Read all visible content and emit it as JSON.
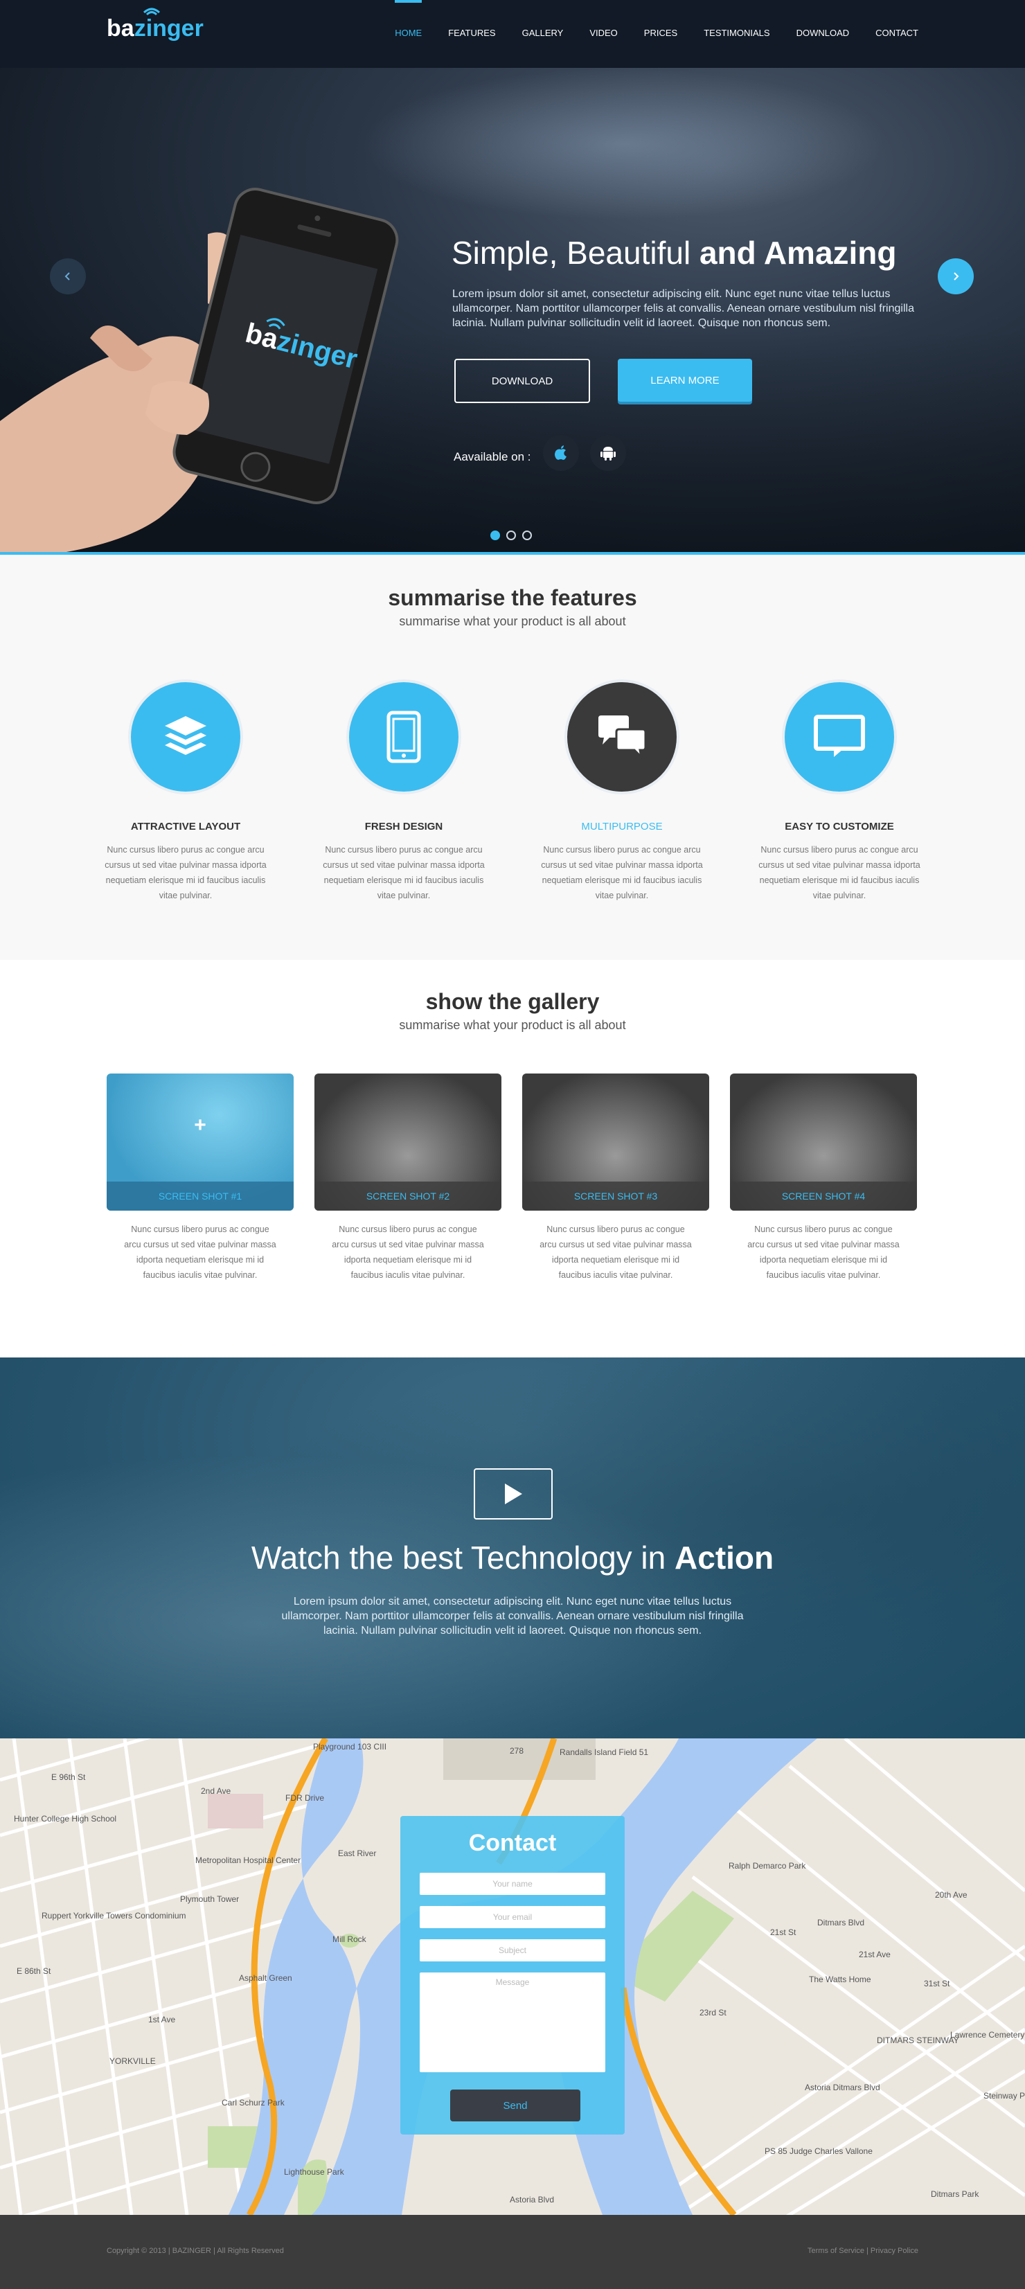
{
  "brand": {
    "prefix": "ba",
    "suffix": "zinger",
    "accent": "#3bbcf0"
  },
  "nav": {
    "items": [
      "HOME",
      "FEATURES",
      "GALLERY",
      "VIDEO",
      "PRICES",
      "TESTIMONIALS",
      "DOWNLOAD",
      "CONTACT"
    ],
    "active": "HOME"
  },
  "hero": {
    "phone_logo_prefix": "ba",
    "phone_logo_suffix": "zinger",
    "title_light": "Simple, Beautiful",
    "title_bold": "and Amazing",
    "text": "Lorem ipsum dolor sit amet, consectetur adipiscing elit. Nunc eget nunc vitae tellus luctus ullamcorper. Nam porttitor ullamcorper felis at convallis. Aenean ornare vestibulum nisl fringilla lacinia. Nullam pulvinar sollicitudin velit id laoreet. Quisque non rhoncus sem.",
    "download_label": "DOWNLOAD",
    "learn_more_label": "LEARN MORE",
    "available_label": "Aavailable on :",
    "slides": {
      "count": 3,
      "active": 1
    },
    "icons": [
      "arrow-left-icon",
      "arrow-right-icon",
      "apple-icon",
      "android-icon"
    ]
  },
  "features": {
    "title": "summarise the features",
    "subtitle": "summarise what your product is all about",
    "items": [
      {
        "title": "ATTRACTIVE LAYOUT",
        "icon": "layers-icon",
        "text": "Nunc cursus libero purus ac congue arcu cursus ut sed vitae pulvinar massa idporta nequetiam elerisque mi id faucibus iaculis vitae pulvinar."
      },
      {
        "title": "FRESH DESIGN",
        "icon": "mobile-icon",
        "text": "Nunc cursus libero purus ac congue arcu cursus ut sed vitae pulvinar massa idporta nequetiam elerisque mi id faucibus iaculis vitae pulvinar."
      },
      {
        "title": "MULTIPURPOSE",
        "icon": "chat-icon",
        "text": "Nunc cursus libero purus ac congue arcu cursus ut sed vitae pulvinar massa idporta nequetiam elerisque mi id faucibus iaculis vitae pulvinar."
      },
      {
        "title": "EASY TO CUSTOMIZE",
        "icon": "monitor-icon",
        "text": "Nunc cursus libero purus ac congue arcu cursus ut sed vitae pulvinar massa idporta nequetiam elerisque mi id faucibus iaculis vitae pulvinar."
      }
    ]
  },
  "gallery": {
    "title": "show the gallery",
    "subtitle": "summarise what your product is all about",
    "plus": "+",
    "items": [
      {
        "caption": "SCREEN SHOT #1",
        "text": "Nunc cursus libero purus ac congue arcu cursus ut sed vitae pulvinar massa idporta nequetiam elerisque mi id faucibus iaculis vitae pulvinar."
      },
      {
        "caption": "SCREEN SHOT #2",
        "text": "Nunc cursus libero purus ac congue arcu cursus ut sed vitae pulvinar massa idporta nequetiam elerisque mi id faucibus iaculis vitae pulvinar."
      },
      {
        "caption": "SCREEN SHOT #3",
        "text": "Nunc cursus libero purus ac congue arcu cursus ut sed vitae pulvinar massa idporta nequetiam elerisque mi id faucibus iaculis vitae pulvinar."
      },
      {
        "caption": "SCREEN SHOT #4",
        "text": "Nunc cursus libero purus ac congue arcu cursus ut sed vitae pulvinar massa idporta nequetiam elerisque mi id faucibus iaculis vitae pulvinar."
      }
    ]
  },
  "video": {
    "title_light": "Watch the best Technology in",
    "title_bold": "Action",
    "text": "Lorem ipsum dolor sit amet, consectetur adipiscing elit. Nunc eget nunc vitae tellus luctus ullamcorper. Nam porttitor ullamcorper felis at convallis. Aenean ornare vestibulum nisl fringilla lacinia. Nullam pulvinar sollicitudin velit id laoreet. Quisque non rhoncus sem."
  },
  "map": {
    "labels": [
      "Randalls Island Field 51",
      "Playground 103 CIII",
      "Hunter College High School",
      "Metropolitan Hospital Center",
      "Plymouth Tower",
      "Ruppert Yorkville Towers Condominium",
      "Mill Rock",
      "Asphalt Green",
      "YORKVILLE",
      "Carl Schurz Park",
      "Lighthouse Park",
      "Astoria Blvd",
      "Ralph Demarco Park",
      "The Watts Home",
      "Astoria Ditmars Blvd",
      "PS 85 Judge Charles Vallone",
      "DITMARS STEINWAY",
      "Lawrence Cemetery",
      "Ditmars Park",
      "E 96th St",
      "E 86th St",
      "1st Ave",
      "2nd Ave",
      "FDR Drive",
      "East River",
      "21st St",
      "23rd St",
      "31st St",
      "20th Ave",
      "21st Ave",
      "Ditmars Blvd",
      "Steinway Playground",
      "278"
    ]
  },
  "contact": {
    "title": "Contact",
    "name_placeholder": "Your name",
    "email_placeholder": "Your email",
    "subject_placeholder": "Subject",
    "message_placeholder": "Message",
    "send_label": "Send"
  },
  "footer": {
    "copyright": "Copyright © 2013 | BAZINGER | All Rights Reserved",
    "links": "Terms of Service | Privacy Police"
  }
}
